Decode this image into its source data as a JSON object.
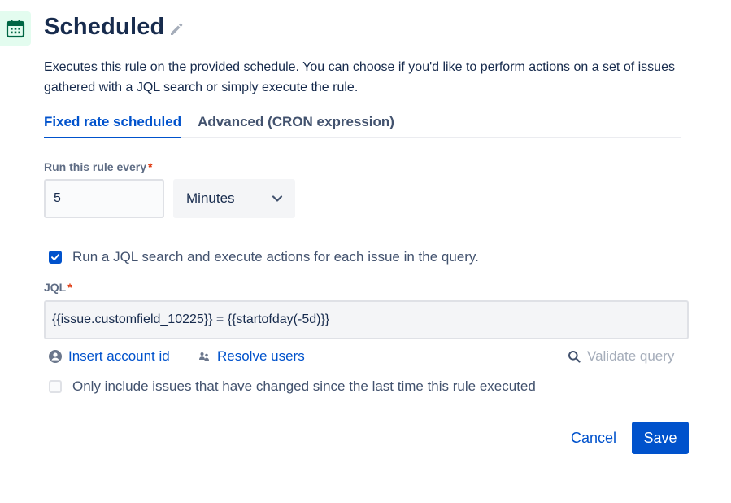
{
  "header": {
    "title": "Scheduled",
    "trigger_icon": "calendar-icon",
    "edit_icon": "pencil-icon",
    "accent_color": "#006644"
  },
  "description": "Executes this rule on the provided schedule. You can choose if you'd like to perform actions on a set of issues gathered with a JQL search or simply execute the rule.",
  "tabs": [
    {
      "label": "Fixed rate scheduled",
      "active": true
    },
    {
      "label": "Advanced (CRON expression)",
      "active": false
    }
  ],
  "schedule": {
    "label": "Run this rule every",
    "required_mark": "*",
    "interval_value": "5",
    "unit_selected": "Minutes"
  },
  "jql_checkbox": {
    "checked": true,
    "label": "Run a JQL search and execute actions for each issue in the query."
  },
  "jql": {
    "label": "JQL",
    "required_mark": "*",
    "value": "{{issue.customfield_10225}} = {{startofday(-5d)}}"
  },
  "helpers": {
    "insert_account_id": "Insert account id",
    "resolve_users": "Resolve users",
    "validate_query": "Validate query"
  },
  "changed_checkbox": {
    "checked": false,
    "label": "Only include issues that have changed since the last time this rule executed"
  },
  "footer": {
    "cancel_label": "Cancel",
    "save_label": "Save"
  },
  "colors": {
    "primary": "#0052cc",
    "text": "#172b4d",
    "muted": "#42526e",
    "required": "#de350b"
  }
}
